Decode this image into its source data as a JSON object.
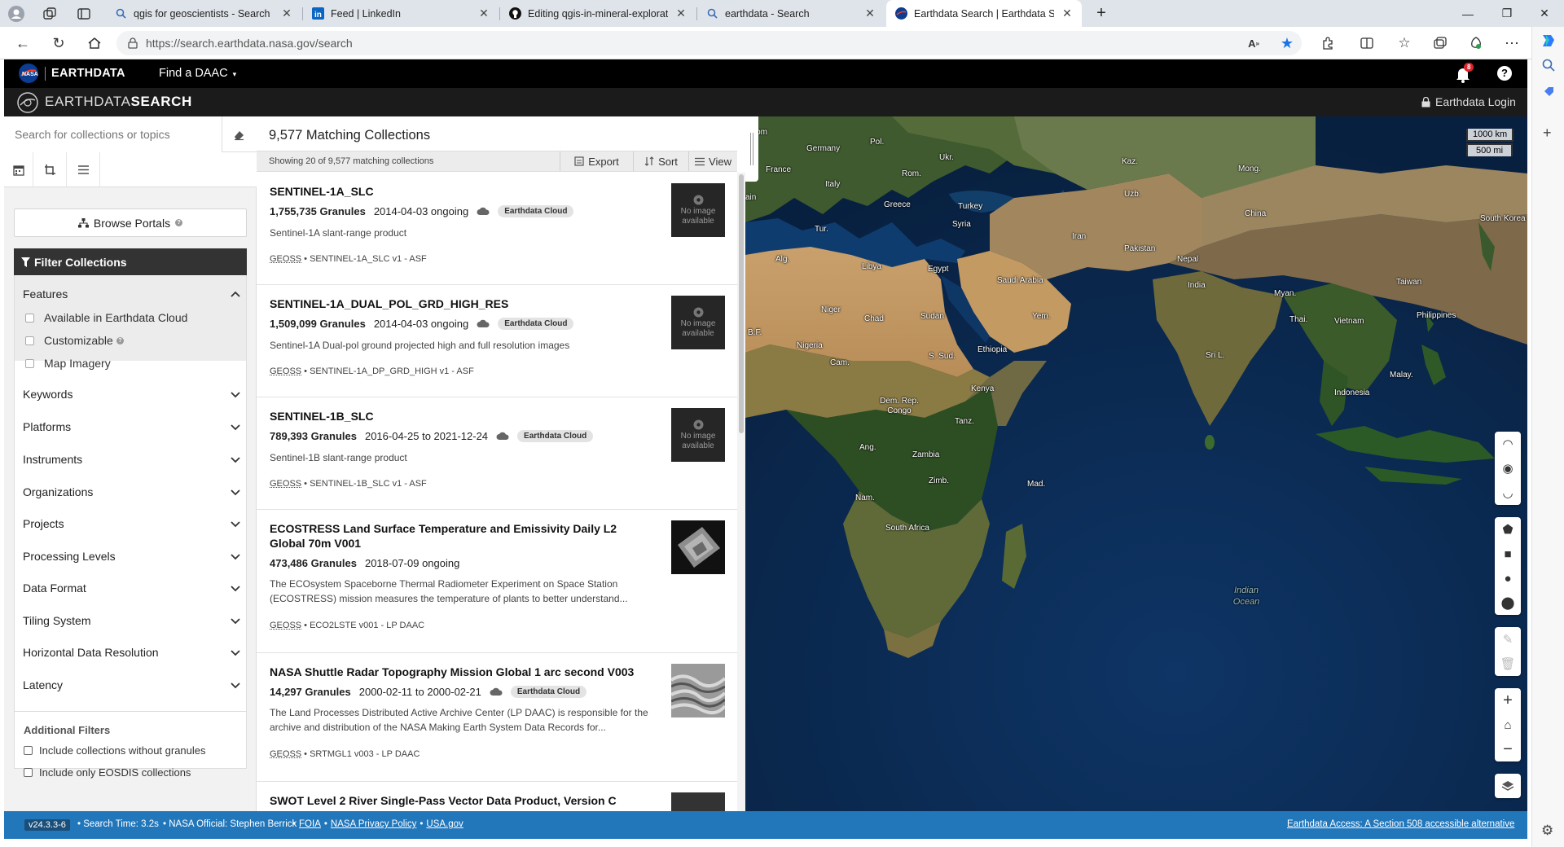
{
  "browser": {
    "tabs": [
      {
        "title": "qgis for geoscientists - Search",
        "icon": "search-icon"
      },
      {
        "title": "Feed | LinkedIn",
        "icon": "linkedin-icon"
      },
      {
        "title": "Editing qgis-in-mineral-exploratio",
        "icon": "github-icon"
      },
      {
        "title": "earthdata - Search",
        "icon": "search-icon"
      },
      {
        "title": "Earthdata Search | Earthdata Sear",
        "icon": "nasa-icon"
      }
    ],
    "url": "https://search.earthdata.nasa.gov/search"
  },
  "global_header": {
    "brand": "EARTHDATA",
    "find_daac": "Find a DAAC",
    "notification_count": "8"
  },
  "search_header": {
    "brand_thin": "EARTHDATA",
    "brand_bold": "SEARCH",
    "login": "Earthdata Login"
  },
  "sidebar": {
    "search_placeholder": "Search for collections or topics",
    "browse_portals": "Browse Portals",
    "filter_title": "Filter Collections",
    "features_label": "Features",
    "features": [
      "Available in Earthdata Cloud",
      "Customizable",
      "Map Imagery"
    ],
    "facets": [
      "Keywords",
      "Platforms",
      "Instruments",
      "Organizations",
      "Projects",
      "Processing Levels",
      "Data Format",
      "Tiling System",
      "Horizontal Data Resolution",
      "Latency"
    ],
    "additional_title": "Additional Filters",
    "additional": [
      "Include collections without granules",
      "Include only EOSDIS collections"
    ]
  },
  "results": {
    "heading": "9,577 Matching Collections",
    "showing": "Showing 20 of 9,577 matching collections",
    "export": "Export",
    "sort": "Sort",
    "view": "View",
    "no_image": "No image available",
    "items": [
      {
        "title": "SENTINEL-1A_SLC",
        "granules": "1,755,735 Granules",
        "dates": "2014-04-03 ongoing",
        "cloud": "Earthdata Cloud",
        "desc": "Sentinel-1A slant-range product",
        "geoss": "GEOSS",
        "meta": " • SENTINEL-1A_SLC v1 - ASF"
      },
      {
        "title": "SENTINEL-1A_DUAL_POL_GRD_HIGH_RES",
        "granules": "1,509,099 Granules",
        "dates": "2014-04-03 ongoing",
        "cloud": "Earthdata Cloud",
        "desc": "Sentinel-1A Dual-pol ground projected high and full resolution images",
        "geoss": "GEOSS",
        "meta": " • SENTINEL-1A_DP_GRD_HIGH v1 - ASF"
      },
      {
        "title": "SENTINEL-1B_SLC",
        "granules": "789,393 Granules",
        "dates": "2016-04-25 to 2021-12-24",
        "cloud": "Earthdata Cloud",
        "desc": "Sentinel-1B slant-range product",
        "geoss": "GEOSS",
        "meta": " • SENTINEL-1B_SLC v1 - ASF"
      },
      {
        "title": "ECOSTRESS Land Surface Temperature and Emissivity Daily L2 Global 70m V001",
        "granules": "473,486 Granules",
        "dates": "2018-07-09 ongoing",
        "cloud": "",
        "desc": "The ECOsystem Spaceborne Thermal Radiometer Experiment on Space Station (ECOSTRESS) mission measures the temperature of plants to better understand...",
        "geoss": "GEOSS",
        "meta": " • ECO2LSTE v001 - LP DAAC"
      },
      {
        "title": "NASA Shuttle Radar Topography Mission Global 1 arc second V003",
        "granules": "14,297 Granules",
        "dates": "2000-02-11 to 2000-02-21",
        "cloud": "Earthdata Cloud",
        "desc": "The Land Processes Distributed Active Archive Center (LP DAAC) is responsible for the archive and distribution of the NASA Making Earth System Data Records for...",
        "geoss": "GEOSS",
        "meta": " • SRTMGL1 v003 - LP DAAC"
      },
      {
        "title": "SWOT Level 2 River Single-Pass Vector Data Product, Version C"
      }
    ]
  },
  "map": {
    "scale_km": "1000 km",
    "scale_mi": "500 mi",
    "labels": [
      "gdom",
      "Germany",
      "Pol.",
      "Ukr.",
      "Kaz.",
      "Mong.",
      "France",
      "Rom.",
      "Italy",
      "Uzb.",
      "Greece",
      "Turkey",
      "China",
      "South Korea",
      "Syria",
      "Tur.",
      "Iran",
      "Pakistan",
      "Alg.",
      "Libya",
      "Egypt",
      "Saudi Arabia",
      "Nepal",
      "India",
      "Myan.",
      "Taiwan",
      "Niger",
      "Chad",
      "Sudan",
      "Yem.",
      "Thai.",
      "Philippines",
      "Vietnam",
      "B.F.",
      "Nigeria",
      "Ethiopia",
      "Sri L.",
      "Malay.",
      "Cam.",
      "S. Sud.",
      "Kenya",
      "Indonesia",
      "Dem. Rep. Congo",
      "Tanz.",
      "Ang.",
      "Zambia",
      "Zimb.",
      "Mad.",
      "Nam.",
      "South Africa",
      "Indian Ocean",
      "ain"
    ]
  },
  "footer": {
    "version": "v24.3.3-6",
    "search_time": "• Search Time: 3.2s",
    "official": "• NASA Official: Stephen Berrick",
    "links": [
      "FOIA",
      "NASA Privacy Policy",
      "USA.gov"
    ],
    "access": "Earthdata Access: A Section 508 accessible alternative"
  },
  "colors": {
    "header": "#000000",
    "subheader": "#1b1b1b",
    "footer": "#2277bb",
    "filter_bar": "#333333",
    "badge": "#e3e3e3"
  }
}
